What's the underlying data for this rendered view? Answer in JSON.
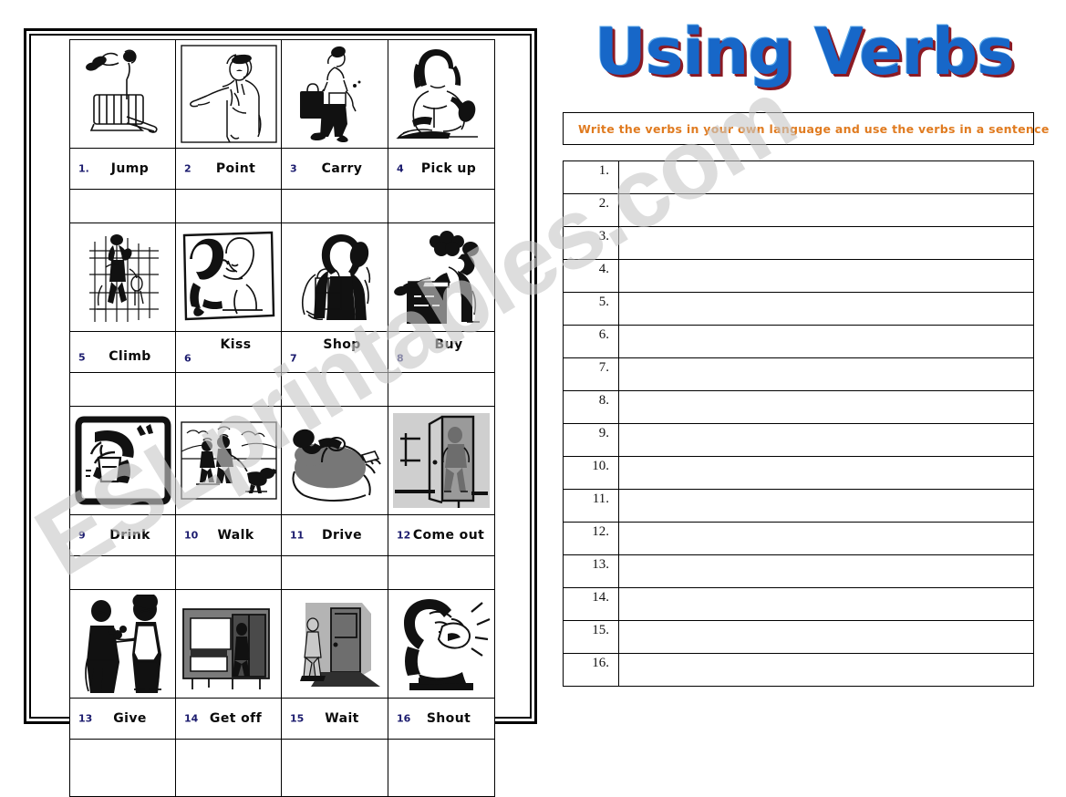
{
  "title": "Using Verbs",
  "watermark": "ESLprintables.com",
  "instruction": "Write the verbs in your own language and use the verbs in a sentence",
  "colors": {
    "title_fill": "#1767c8",
    "title_shadow": "#8b1a24",
    "instruction_text": "#e07b20",
    "label_number": "#1b1b6e",
    "label_word": "#0a0a0a",
    "watermark": "#c9c9c9",
    "border": "#000000",
    "background": "#ffffff"
  },
  "verb_table": {
    "columns": 4,
    "rows": 4,
    "items": [
      {
        "number": "1.",
        "word": "Jump",
        "icon": "person-jumping-over-box-icon"
      },
      {
        "number": "2",
        "word": "Point",
        "icon": "person-pointing-icon"
      },
      {
        "number": "3",
        "word": "Carry",
        "icon": "person-carrying-bag-icon"
      },
      {
        "number": "4",
        "word": "Pick up",
        "icon": "person-picking-up-clothes-icon"
      },
      {
        "number": "5",
        "word": "Climb",
        "icon": "person-climbing-fence-icon"
      },
      {
        "number": "6",
        "word": "Kiss",
        "icon": "couple-kissing-icon"
      },
      {
        "number": "7",
        "word": "Shop",
        "icon": "woman-with-shopping-bags-icon"
      },
      {
        "number": "8",
        "word": "Buy",
        "icon": "man-buying-at-gift-shop-icon"
      },
      {
        "number": "9",
        "word": "Drink",
        "icon": "person-drinking-glass-icon"
      },
      {
        "number": "10",
        "word": "Walk",
        "icon": "couple-walking-dog-icon"
      },
      {
        "number": "11",
        "word": "Drive",
        "icon": "person-driving-car-icon"
      },
      {
        "number": "12",
        "word": "Come out",
        "icon": "person-coming-out-of-door-icon"
      },
      {
        "number": "13",
        "word": "Give",
        "icon": "man-giving-flowers-icon"
      },
      {
        "number": "14",
        "word": "Get off",
        "icon": "person-getting-off-bus-icon"
      },
      {
        "number": "15",
        "word": "Wait",
        "icon": "person-waiting-at-door-icon"
      },
      {
        "number": "16",
        "word": "Shout",
        "icon": "woman-shouting-icon"
      }
    ]
  },
  "answer_table": {
    "row_numbers": [
      "1.",
      "2.",
      "3.",
      "4.",
      "5.",
      "6.",
      "7.",
      "8.",
      "9.",
      "10.",
      "11.",
      "12.",
      "13.",
      "14.",
      "15.",
      "16."
    ],
    "answers": [
      "",
      "",
      "",
      "",
      "",
      "",
      "",
      "",
      "",
      "",
      "",
      "",
      "",
      "",
      "",
      ""
    ]
  }
}
